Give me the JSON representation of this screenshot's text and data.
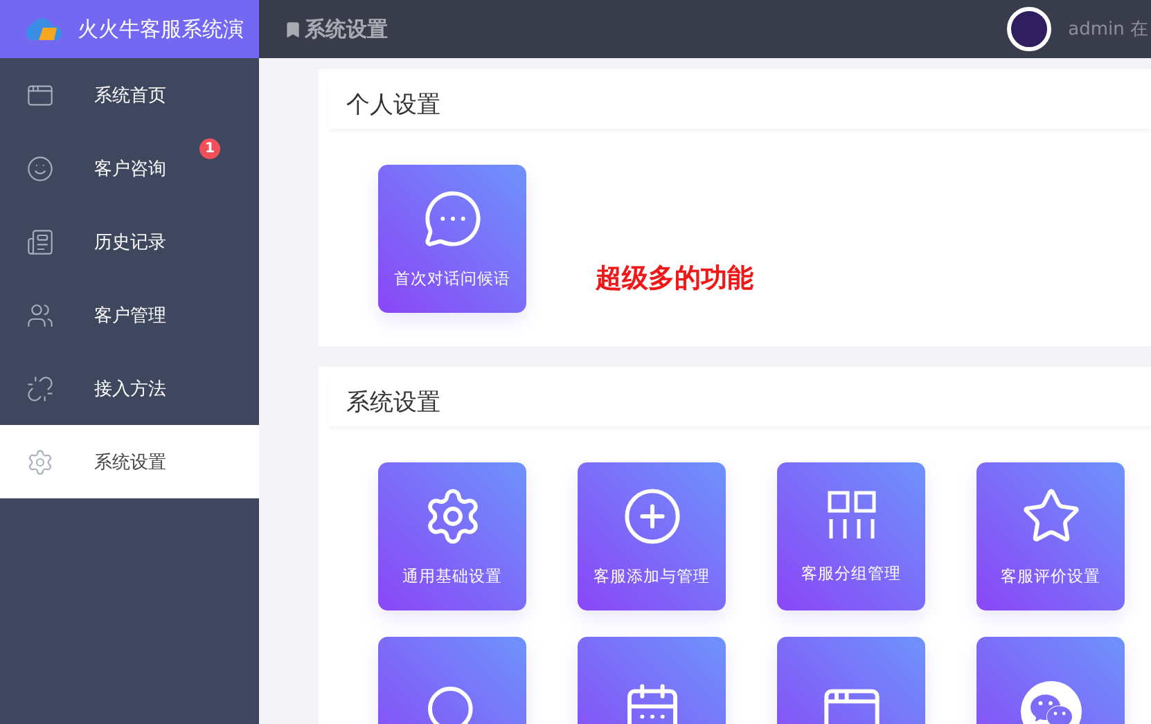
{
  "brand": {
    "title": "火火牛客服系统演"
  },
  "header": {
    "page_title": "系统设置",
    "user": "admin 在"
  },
  "sidebar": {
    "items": [
      {
        "kind": "window",
        "label": "系统首页",
        "selected": false
      },
      {
        "kind": "smile",
        "label": "客户咨询",
        "selected": false,
        "badge": "1"
      },
      {
        "kind": "news",
        "label": "历史记录",
        "selected": false
      },
      {
        "kind": "users",
        "label": "客户管理",
        "selected": false
      },
      {
        "kind": "unlink",
        "label": "接入方法",
        "selected": false
      },
      {
        "kind": "gear",
        "label": "系统设置",
        "selected": true
      }
    ]
  },
  "sections": [
    {
      "title": "个人设置",
      "note": "超级多的功能",
      "tiles": [
        {
          "kind": "chat",
          "label": "首次对话问候语"
        }
      ]
    },
    {
      "title": "系统设置",
      "tiles": [
        {
          "kind": "gear",
          "label": "通用基础设置"
        },
        {
          "kind": "plus",
          "label": "客服添加与管理"
        },
        {
          "kind": "groups",
          "label": "客服分组管理"
        },
        {
          "kind": "star",
          "label": "客服评价设置"
        },
        {
          "kind": "search"
        },
        {
          "kind": "calendar"
        },
        {
          "kind": "window"
        },
        {
          "kind": "wechat"
        }
      ]
    }
  ]
}
